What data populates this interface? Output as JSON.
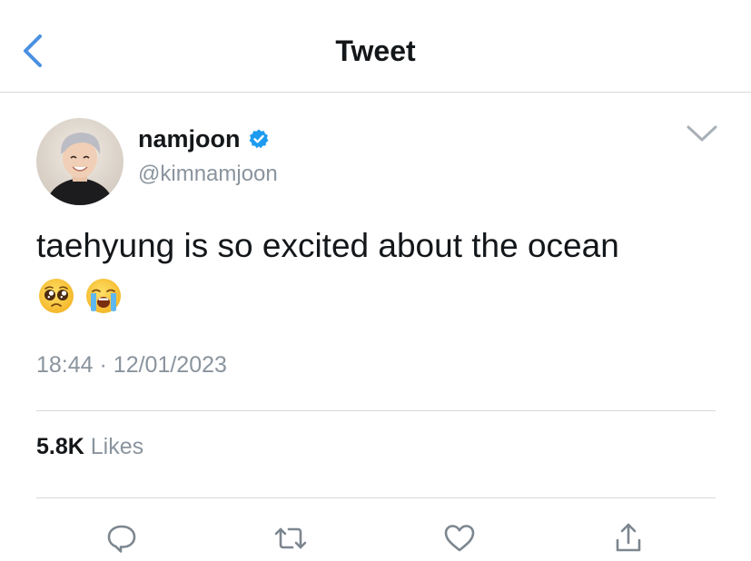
{
  "header": {
    "title": "Tweet",
    "back_icon": "chevron-left-icon"
  },
  "author": {
    "display_name": "namjoon",
    "handle": "@kimnamjoon",
    "verified": true,
    "verified_icon": "verified-badge-icon"
  },
  "tweet": {
    "text": "taehyung is so excited about the ocean",
    "emojis": [
      "pleading-face-emoji",
      "loudly-crying-face-emoji"
    ],
    "time": "18:44",
    "separator": "·",
    "date": "12/01/2023"
  },
  "stats": {
    "likes_count": "5.8K",
    "likes_label": "Likes"
  },
  "actions": [
    {
      "name": "reply",
      "icon": "comment-bubble-icon"
    },
    {
      "name": "retweet",
      "icon": "retweet-icon"
    },
    {
      "name": "like",
      "icon": "heart-icon"
    },
    {
      "name": "share",
      "icon": "share-upload-icon"
    }
  ],
  "colors": {
    "accent_blue": "#4a90e2",
    "verified_blue": "#1d9bf0",
    "muted_text": "#8a949e",
    "icon_gray": "#7c868f",
    "divider": "#d8d8d8"
  }
}
